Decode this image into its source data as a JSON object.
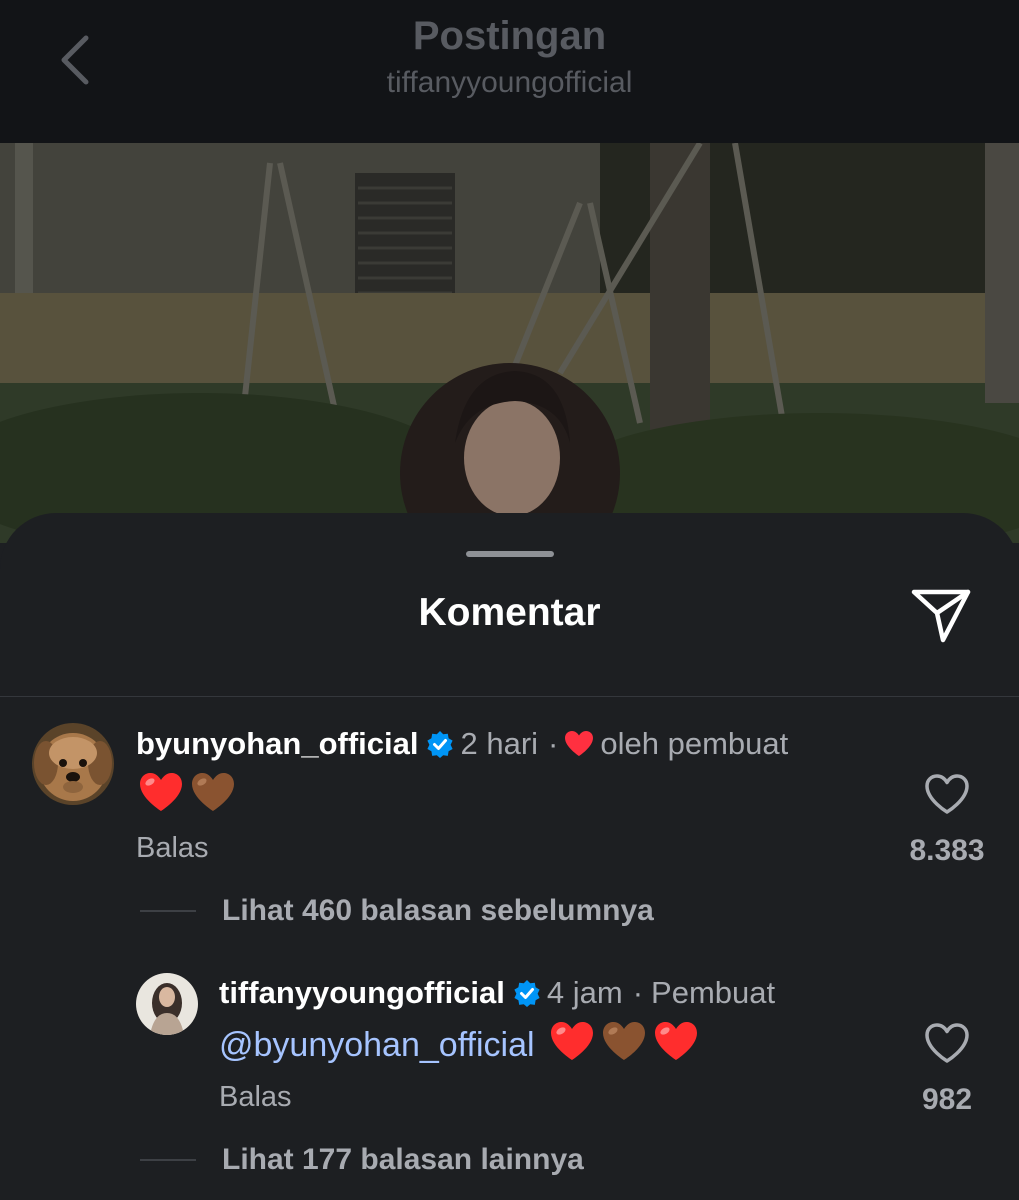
{
  "header": {
    "title": "Postingan",
    "subtitle": "tiffanyyoungofficial",
    "back_icon": "chevron-left-icon"
  },
  "sheet": {
    "title": "Komentar",
    "share_icon": "send-icon"
  },
  "comments": [
    {
      "username": "byunyohan_official",
      "verified": true,
      "time": "2 hari",
      "separator": "·",
      "liked_by_creator_label": "oleh pembuat",
      "emojis": [
        "red-heart-emoji",
        "brown-heart-emoji"
      ],
      "reply_label": "Balas",
      "like_count": "8.383",
      "view_replies": "Lihat 460 balasan sebelumnya"
    },
    {
      "username": "tiffanyyoungofficial",
      "verified": true,
      "time": "4 jam",
      "separator": "·",
      "creator_label": "Pembuat",
      "mention": "@byunyohan_official",
      "emojis": [
        "red-heart-emoji",
        "brown-heart-emoji",
        "red-heart-emoji"
      ],
      "reply_label": "Balas",
      "like_count": "982",
      "view_replies": "Lihat 177 balasan lainnya"
    }
  ],
  "colors": {
    "header_bg": "#121417",
    "sheet_bg": "#1d1f22",
    "verified_blue": "#0095f6",
    "heart_red": "#ff3040",
    "mention_blue": "#a6c4ff",
    "muted_text": "#a8abb1"
  }
}
